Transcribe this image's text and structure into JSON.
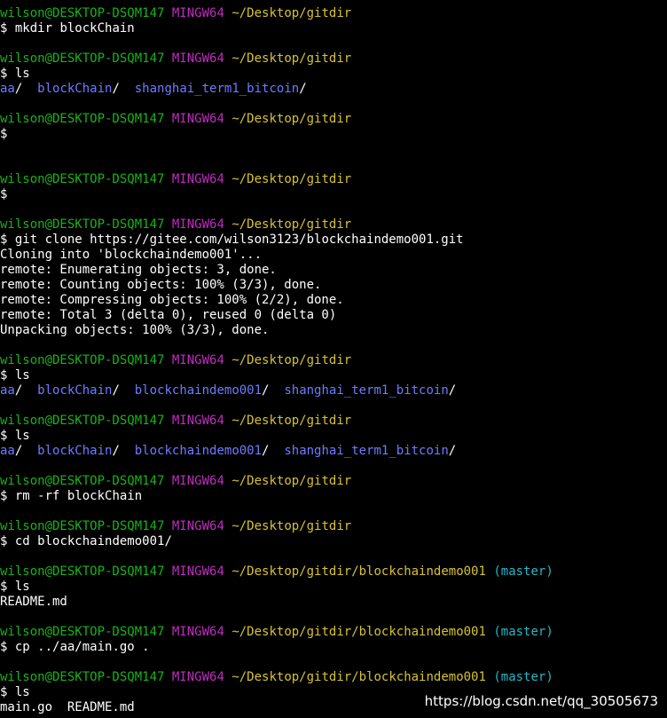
{
  "prompt": {
    "user": "wilson@DESKTOP-DSQM147",
    "host": "MINGW64",
    "path_gitdir": "~/Desktop/gitdir",
    "path_demo": "~/Desktop/gitdir/blockchaindemo001",
    "branch": "(master)",
    "dollar": "$"
  },
  "commands": {
    "mkdir": "mkdir blockChain",
    "ls": "ls",
    "git_clone": "git clone https://gitee.com/wilson3123/blockchaindemo001.git",
    "rm": "rm -rf blockChain",
    "cd": "cd blockchaindemo001/",
    "cp": "cp ../aa/main.go ."
  },
  "clone_output": [
    "Cloning into 'blockchaindemo001'...",
    "remote: Enumerating objects: 3, done.",
    "remote: Counting objects: 100% (3/3), done.",
    "remote: Compressing objects: 100% (2/2), done.",
    "remote: Total 3 (delta 0), reused 0 (delta 0)",
    "Unpacking objects: 100% (3/3), done."
  ],
  "listings": {
    "first": [
      "aa",
      "blockChain",
      "shanghai_term1_bitcoin"
    ],
    "second": [
      "aa",
      "blockChain",
      "blockchaindemo001",
      "shanghai_term1_bitcoin"
    ],
    "readme_only": "README.md",
    "with_main": "main.go  README.md"
  },
  "watermark": "https://blog.csdn.net/qq_30505673",
  "colors": {
    "user": "#17b317",
    "host": "#c02cc0",
    "path": "#d7c32f",
    "branch": "#25b7c7",
    "directory": "#6e7cff",
    "background": "#000000"
  }
}
